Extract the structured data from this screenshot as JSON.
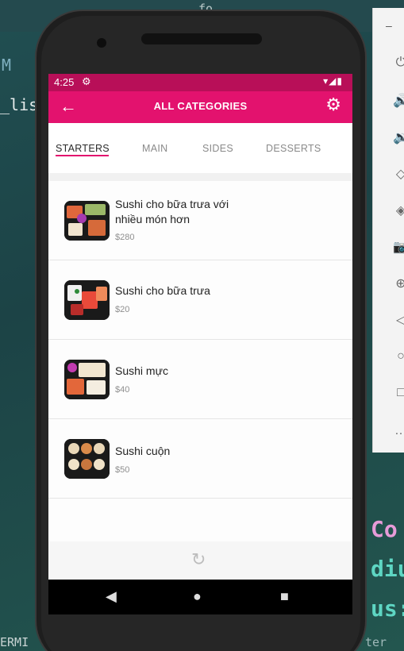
{
  "background": {
    "search_hint": "fo",
    "gutter_letter": "M",
    "code_fragment": "_listF",
    "terminal_label": "ERMI",
    "bottom_right_text": "ter (e",
    "right_code": [
      "Co",
      "diu",
      "us:"
    ]
  },
  "emulator_toolbar": {
    "title": "–",
    "buttons": [
      "power-icon",
      "volume-up-icon",
      "volume-down-icon",
      "rotate-left-icon",
      "rotate-right-icon",
      "camera-icon",
      "zoom-icon",
      "back-icon",
      "home-icon",
      "overview-icon",
      "more-icon"
    ]
  },
  "status_bar": {
    "time": "4:25",
    "icons": "▾◢▮"
  },
  "app_bar": {
    "title": "ALL CATEGORIES"
  },
  "tabs": [
    {
      "label": "STARTERS",
      "active": true
    },
    {
      "label": "MAIN",
      "active": false
    },
    {
      "label": "SIDES",
      "active": false
    },
    {
      "label": "DESSERTS",
      "active": false
    }
  ],
  "items": [
    {
      "name": "Sushi cho bữa trưa với nhiều món hơn",
      "price": "$280"
    },
    {
      "name": "Sushi cho bữa trưa",
      "price": "$20"
    },
    {
      "name": "Sushi mực",
      "price": "$40"
    },
    {
      "name": "Sushi cuộn",
      "price": "$50"
    }
  ],
  "colors": {
    "status_bar": "#b80f58",
    "app_bar": "#e3126e",
    "accent": "#e3126e"
  }
}
